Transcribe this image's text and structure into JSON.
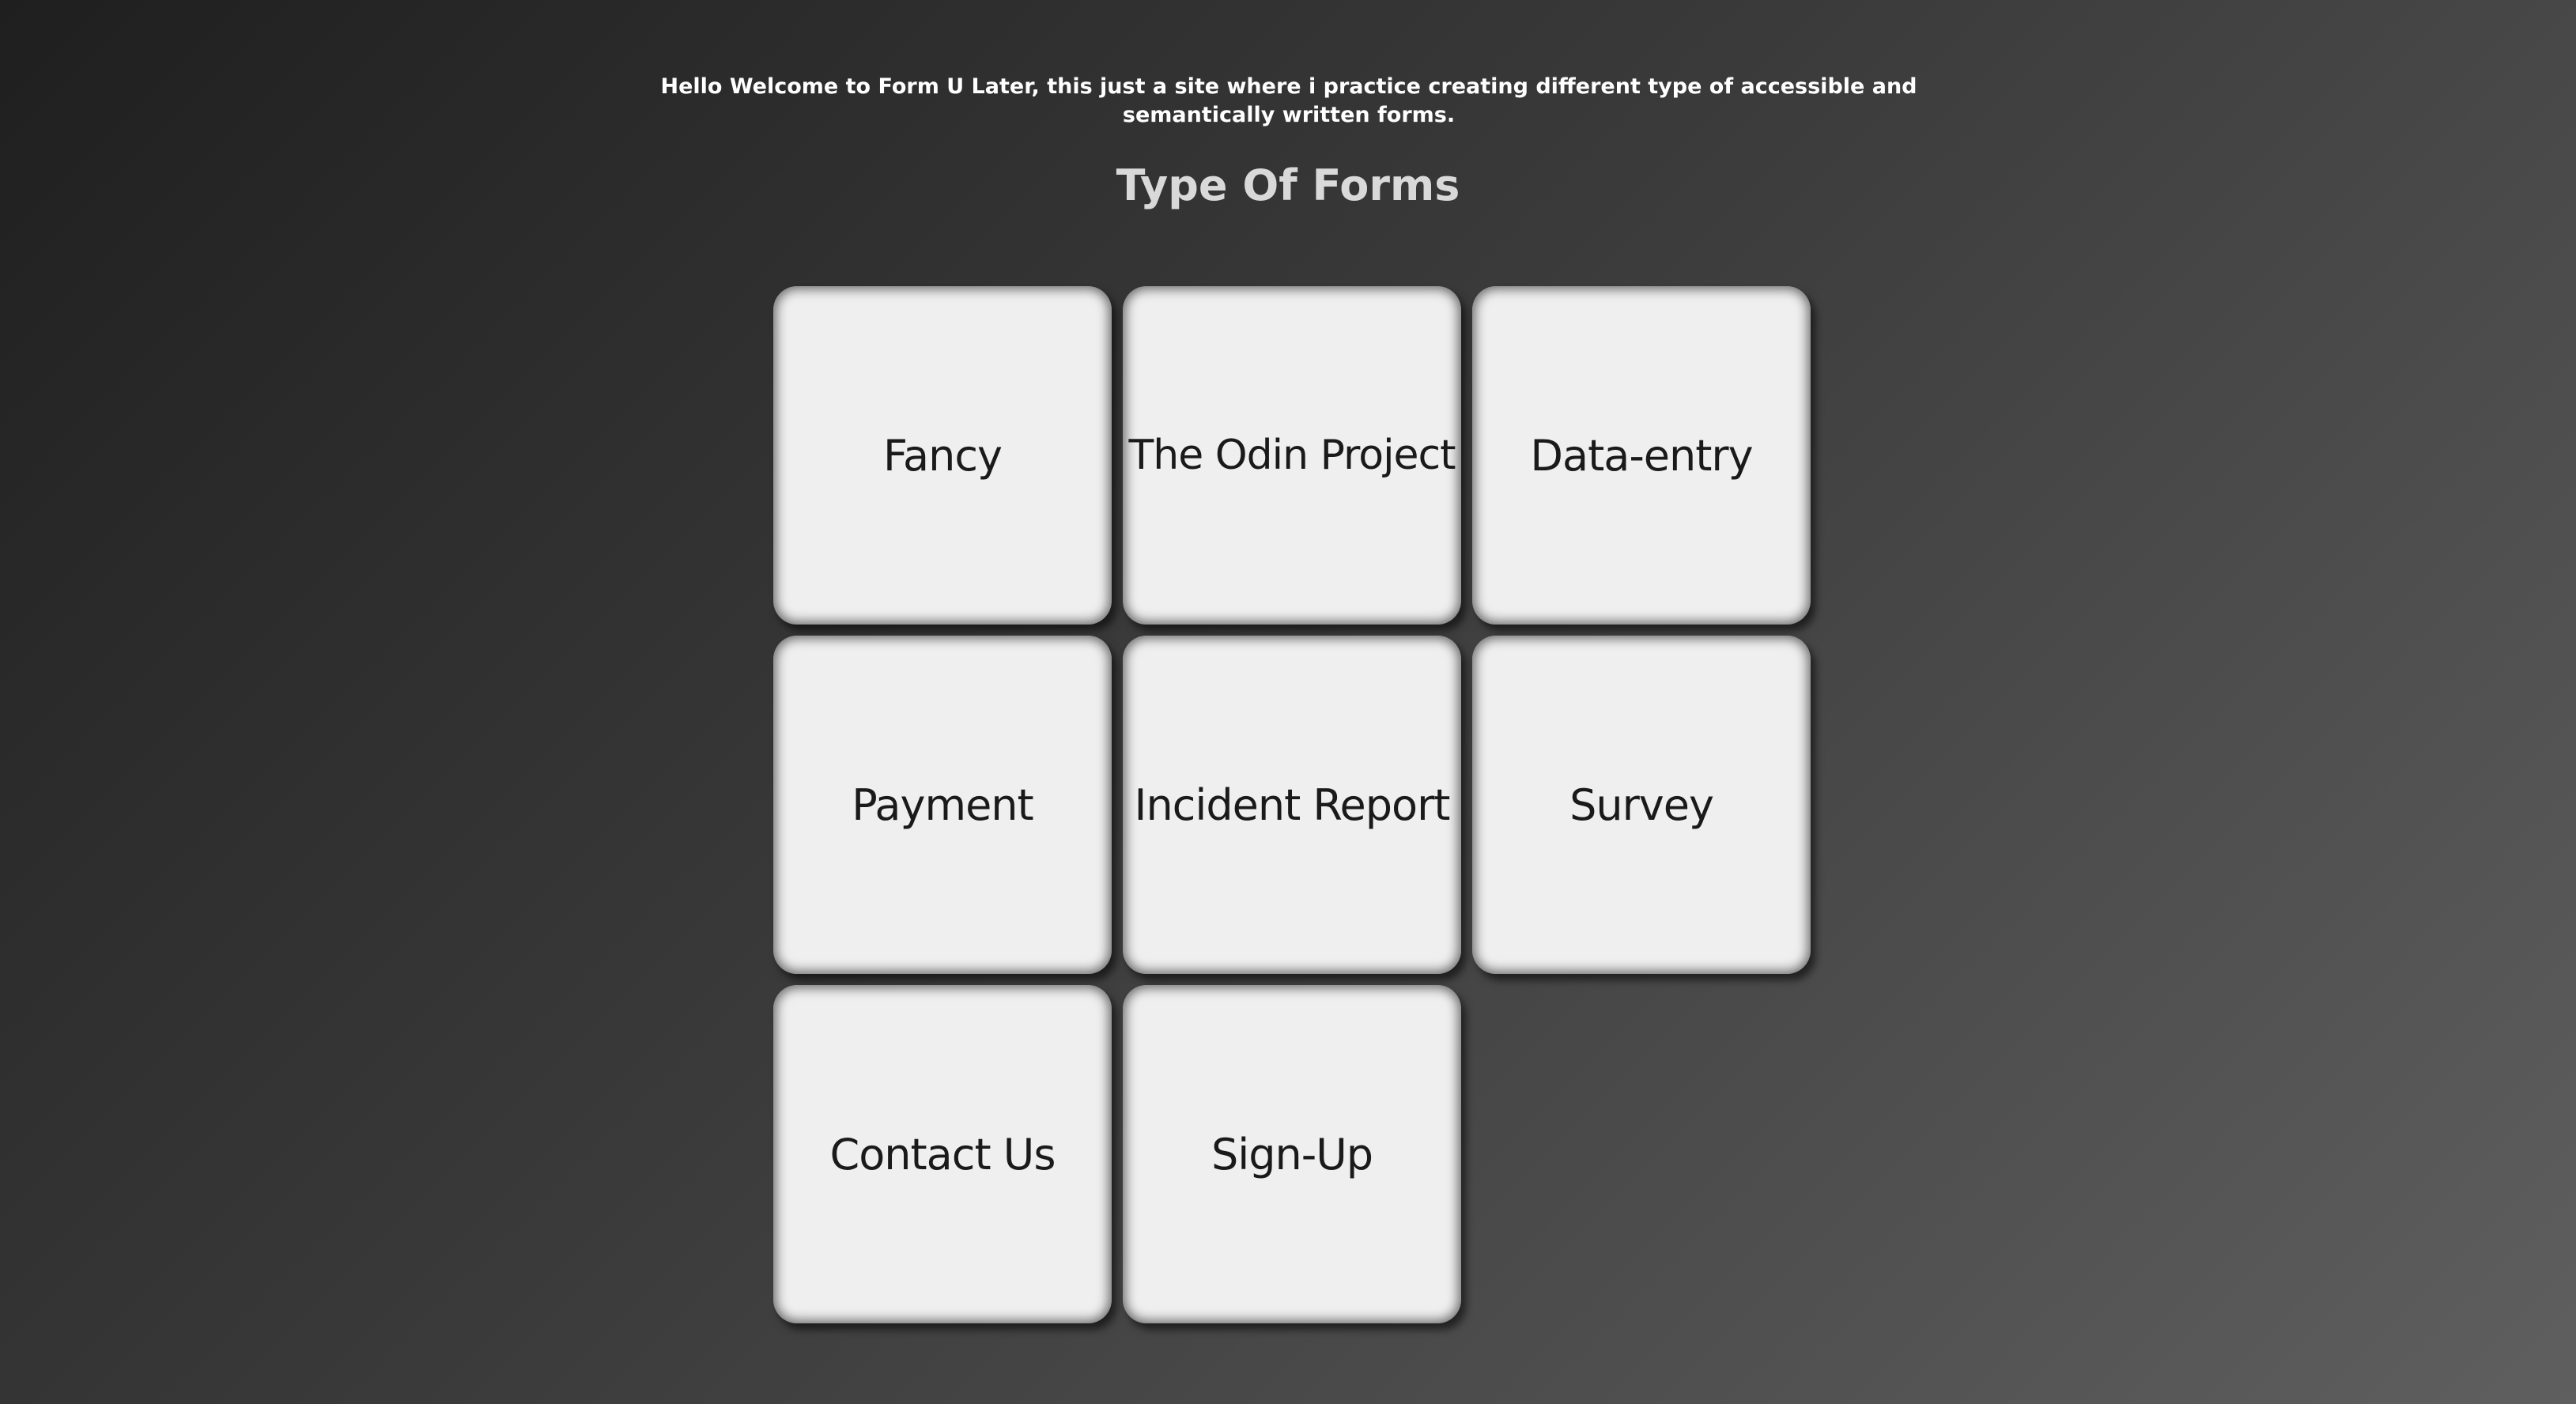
{
  "intro_text": "Hello Welcome to Form U Later, this just a site where i practice creating different type of accessible and semantically written forms.",
  "heading": "Type Of Forms",
  "cards": [
    {
      "label": "Fancy"
    },
    {
      "label": "The Odin Project"
    },
    {
      "label": "Data-entry"
    },
    {
      "label": "Payment"
    },
    {
      "label": "Incident Report"
    },
    {
      "label": "Survey"
    },
    {
      "label": "Contact Us"
    },
    {
      "label": "Sign-Up"
    }
  ],
  "colors": {
    "card_background": "#efefef",
    "heading": "#d9d9d9",
    "intro_text": "#ffffff",
    "card_text": "#1a1a1a"
  }
}
